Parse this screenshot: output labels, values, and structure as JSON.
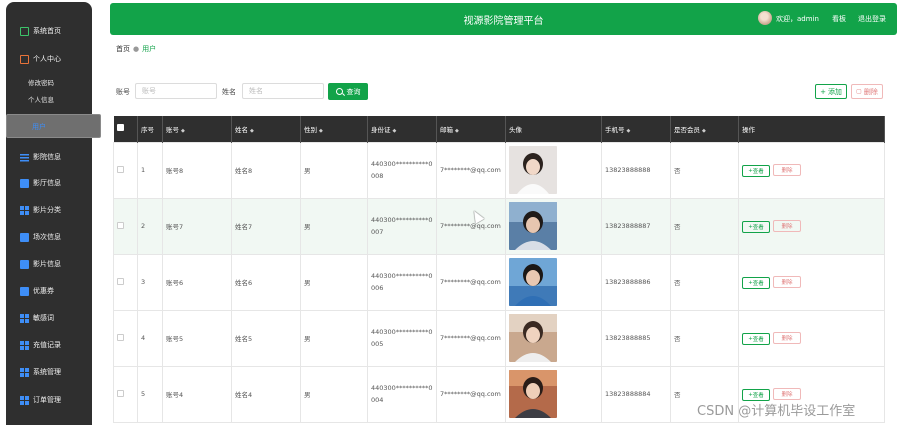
{
  "sidebar": {
    "items": [
      {
        "label": "系统首页",
        "icon": "home-icon"
      },
      {
        "label": "个人中心",
        "icon": "user-icon"
      },
      {
        "label": "用户",
        "icon": "grid-icon"
      },
      {
        "label": "影院信息",
        "icon": "list-icon"
      },
      {
        "label": "影厅信息",
        "icon": "doc-icon"
      },
      {
        "label": "影片分类",
        "icon": "grid-icon"
      },
      {
        "label": "场次信息",
        "icon": "doc-icon"
      },
      {
        "label": "影片信息",
        "icon": "doc-icon"
      },
      {
        "label": "优惠券",
        "icon": "doc-icon"
      },
      {
        "label": "敏感词",
        "icon": "grid-icon"
      },
      {
        "label": "充值记录",
        "icon": "grid-icon"
      },
      {
        "label": "系统管理",
        "icon": "grid-icon"
      },
      {
        "label": "订单管理",
        "icon": "grid-icon"
      }
    ],
    "subitems": [
      "修改密码",
      "个人信息"
    ]
  },
  "header": {
    "title": "视源影院管理平台",
    "welcome": "欢迎，admin",
    "board": "看板",
    "logout": "退出登录"
  },
  "breadcrumb": {
    "home": "首页",
    "current": "用户"
  },
  "search": {
    "account_label": "账号",
    "account_placeholder": "账号",
    "name_label": "姓名",
    "name_placeholder": "姓名",
    "button": "查询"
  },
  "actions": {
    "add": "添加",
    "delete": "删除"
  },
  "table": {
    "headers": [
      "序号",
      "账号",
      "姓名",
      "性别",
      "身份证",
      "邮箱",
      "头像",
      "手机号",
      "是否会员",
      "操作"
    ],
    "view_label": "查看",
    "delete_label": "删除",
    "rows": [
      {
        "no": "1",
        "account": "账号8",
        "name": "姓名8",
        "gender": "男",
        "id_card": "440300**********0008",
        "email": "7********@qq.com",
        "phone": "13823888888",
        "member": "否"
      },
      {
        "no": "2",
        "account": "账号7",
        "name": "姓名7",
        "gender": "男",
        "id_card": "440300**********0007",
        "email": "7********@qq.com",
        "phone": "13823888887",
        "member": "否"
      },
      {
        "no": "3",
        "account": "账号6",
        "name": "姓名6",
        "gender": "男",
        "id_card": "440300**********0006",
        "email": "7********@qq.com",
        "phone": "13823888886",
        "member": "否"
      },
      {
        "no": "4",
        "account": "账号5",
        "name": "姓名5",
        "gender": "男",
        "id_card": "440300**********0005",
        "email": "7********@qq.com",
        "phone": "13823888885",
        "member": "否"
      },
      {
        "no": "5",
        "account": "账号4",
        "name": "姓名4",
        "gender": "男",
        "id_card": "440300**********0004",
        "email": "7********@qq.com",
        "phone": "13823888884",
        "member": "否"
      }
    ]
  },
  "watermark": "CSDN @计算机毕设工作室",
  "colors": {
    "accent": "#12a349",
    "sidebar": "#2f2f2f",
    "danger": "#e07c7c"
  }
}
